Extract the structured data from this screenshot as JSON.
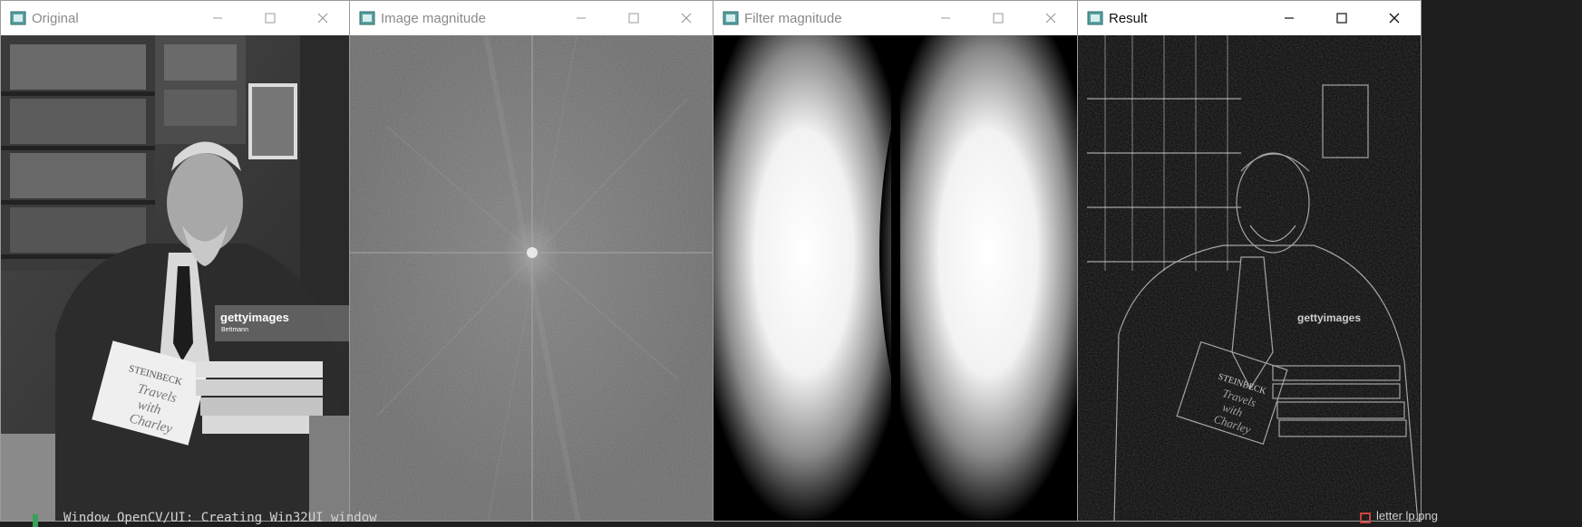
{
  "windows": [
    {
      "title": "Original",
      "active": false
    },
    {
      "title": "Image magnitude",
      "active": false
    },
    {
      "title": "Filter magnitude",
      "active": false
    },
    {
      "title": "Result",
      "active": true
    }
  ],
  "original_image": {
    "watermark": "gettyimages",
    "watermark_sub": "Bettmann",
    "book_author": "STEINBECK",
    "book_title_lines": [
      "Travels",
      "with",
      "Charley"
    ]
  },
  "result_image": {
    "watermark": "gettyimages",
    "book_author": "STEINBECK",
    "book_title_lines": [
      "Travels",
      "with",
      "Charley"
    ]
  },
  "console": {
    "text": "Window OpenCV/UI: Creating Win32UI window",
    "taskbar_item": "letter lp.png"
  },
  "colors": {
    "titlebar": "#ffffff",
    "inactive_title": "#8a8a8a",
    "active_title": "#111111",
    "console_bg": "#1e1e1e"
  }
}
